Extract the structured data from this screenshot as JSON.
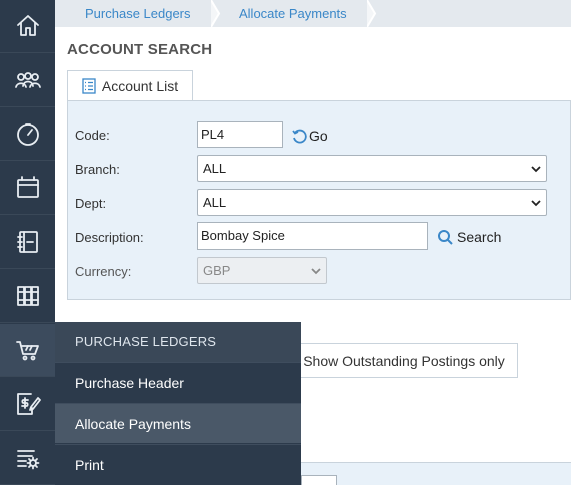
{
  "nav": {
    "items": [
      {
        "icon": "home-icon"
      },
      {
        "icon": "users-icon"
      },
      {
        "icon": "dashboard-icon"
      },
      {
        "icon": "archive-icon"
      },
      {
        "icon": "ledger-book-icon"
      },
      {
        "icon": "books-icon"
      },
      {
        "icon": "cart-icon",
        "active": true
      },
      {
        "icon": "invoice-pen-icon"
      },
      {
        "icon": "settings-list-icon"
      }
    ]
  },
  "breadcrumb": [
    "Purchase Ledgers",
    "Allocate Payments"
  ],
  "page": {
    "section_title": "ACCOUNT SEARCH",
    "account_list_label": "Account List"
  },
  "form": {
    "code_label": "Code:",
    "code_value": "PL4",
    "go_label": "Go",
    "branch_label": "Branch:",
    "branch_value": "ALL",
    "dept_label": "Dept:",
    "dept_value": "ALL",
    "description_label": "Description:",
    "description_value": "Bombay Spice",
    "search_label": "Search",
    "currency_label": "Currency:",
    "currency_value": "GBP"
  },
  "outstanding_label": "Show Outstanding Postings only",
  "flyout": {
    "header": "PURCHASE LEDGERS",
    "items": [
      "Purchase Header",
      "Allocate Payments",
      "Print"
    ],
    "active_index": 1
  },
  "colors": {
    "rail": "#2c3a4b",
    "accent": "#3a87c8",
    "panel": "#e8f1f9"
  }
}
